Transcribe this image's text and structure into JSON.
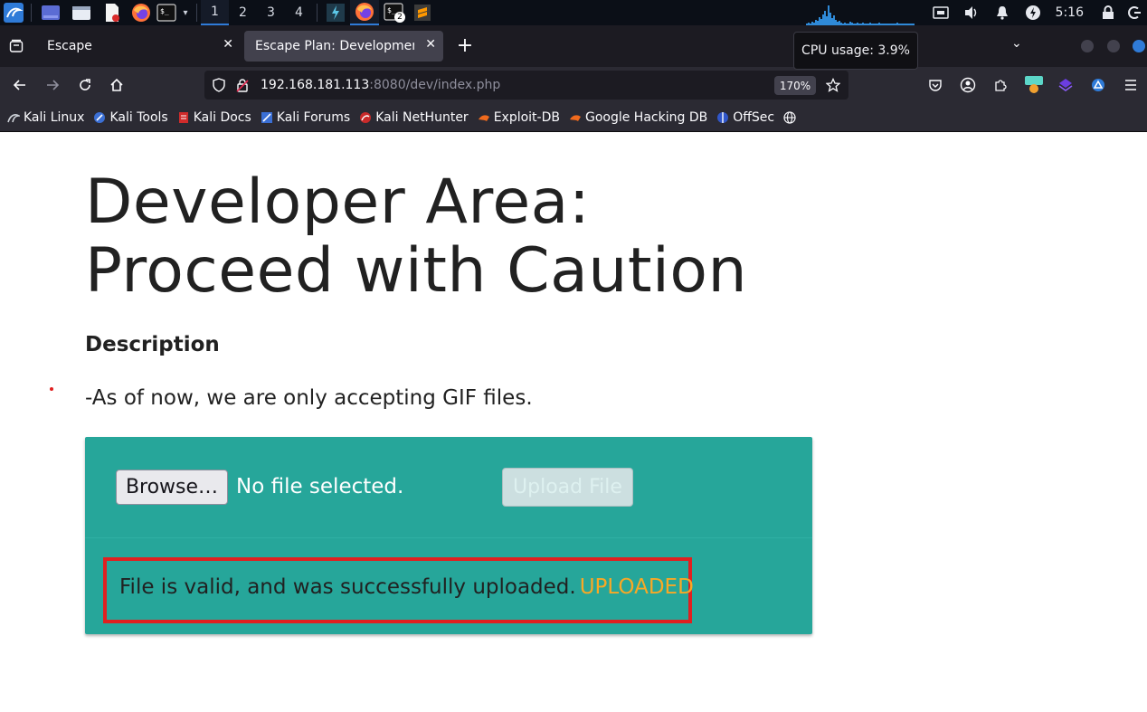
{
  "taskbar": {
    "workspaces": [
      "1",
      "2",
      "3",
      "4"
    ],
    "terminal_badge": "2",
    "clock": "5:16",
    "launchers": [
      "kali-menu-icon",
      "desktop-icon",
      "file-manager-icon",
      "text-editor-icon",
      "firefox-icon",
      "terminal-icon"
    ],
    "colors": {
      "background": "#0b0f17",
      "accent": "#2f7bd8"
    }
  },
  "browser": {
    "tabs": [
      {
        "title": "Escape",
        "selected": false
      },
      {
        "title": "Escape Plan: Development Ce",
        "selected": true
      }
    ],
    "new_tab_label": "+",
    "tooltip": "CPU usage: 3.9%",
    "url": {
      "host": "192.168.181.113",
      "path": ":8080/dev/index.php"
    },
    "zoom": "170%",
    "bookmarks": [
      {
        "label": "Kali Linux",
        "icon": "kali-dragon-icon"
      },
      {
        "label": "Kali Tools",
        "icon": "kali-tools-icon"
      },
      {
        "label": "Kali Docs",
        "icon": "kali-docs-icon"
      },
      {
        "label": "Kali Forums",
        "icon": "kali-forums-icon"
      },
      {
        "label": "Kali NetHunter",
        "icon": "nethunter-icon"
      },
      {
        "label": "Exploit-DB",
        "icon": "exploit-db-icon"
      },
      {
        "label": "Google Hacking DB",
        "icon": "ghdb-icon"
      },
      {
        "label": "OffSec",
        "icon": "offsec-icon"
      }
    ]
  },
  "page": {
    "heading_line1": "Developer Area:",
    "heading_line2": "Proceed with Caution",
    "description_label": "Description",
    "description_text": "-As of now, we are only accepting GIF files.",
    "browse_label": "Browse…",
    "no_file_text": "No file selected.",
    "upload_label": "Upload File",
    "status_message": "File is valid, and was successfully uploaded.",
    "status_flag": "UPLOADED",
    "colors": {
      "card": "#26a69a",
      "highlight_border": "#e02020",
      "flag": "#f9a825"
    }
  }
}
